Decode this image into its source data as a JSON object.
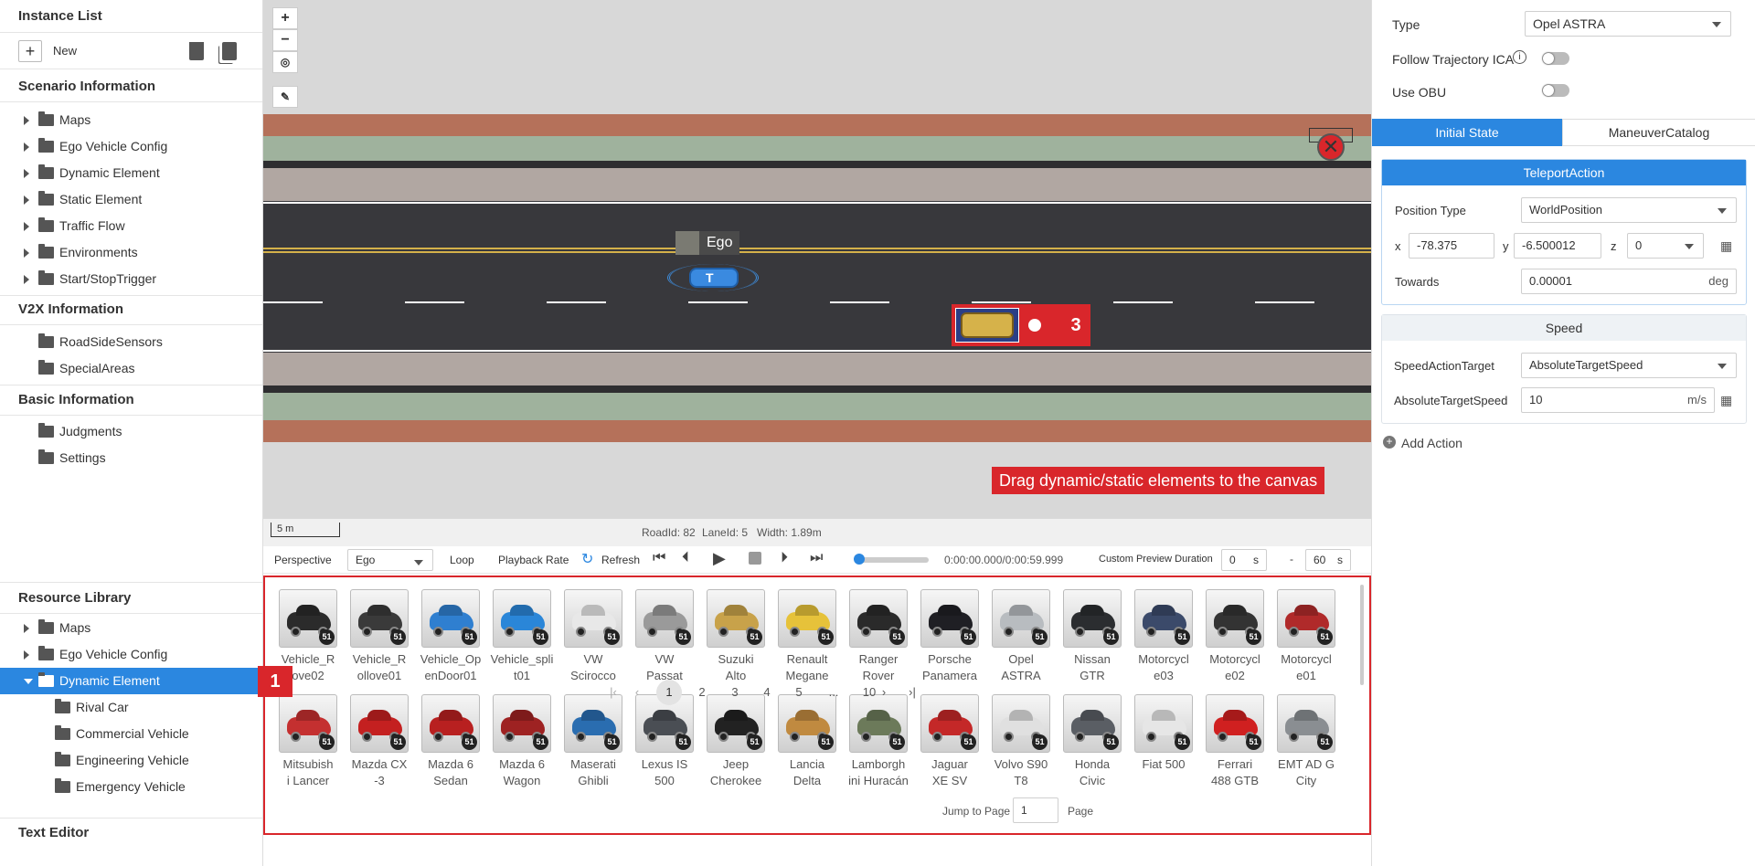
{
  "instance_list": {
    "title": "Instance List",
    "new_label": "New"
  },
  "scenario_info": {
    "title": "Scenario Information",
    "items": [
      "Maps",
      "Ego Vehicle Config",
      "Dynamic Element",
      "Static Element",
      "Traffic Flow",
      "Environments",
      "Start/StopTrigger"
    ]
  },
  "v2x_info": {
    "title": "V2X Information",
    "items": [
      "RoadSideSensors",
      "SpecialAreas"
    ]
  },
  "basic_info": {
    "title": "Basic Information",
    "items": [
      "Judgments",
      "Settings"
    ]
  },
  "resource_library": {
    "title": "Resource Library",
    "items": [
      "Maps",
      "Ego Vehicle Config",
      "Dynamic Element"
    ],
    "sub_items": [
      "Rival Car",
      "Commercial Vehicle",
      "Engineering Vehicle",
      "Emergency Vehicle"
    ]
  },
  "text_editor": {
    "title": "Text Editor"
  },
  "canvas": {
    "zoom_in": "+",
    "zoom_out": "−",
    "ego_label": "Ego",
    "rival_number": "3",
    "hint": "Drag dynamic/static elements to the canvas",
    "scale": "5 m",
    "road_id": "RoadId: 82",
    "lane_id": "LaneId: 5",
    "width": "Width: 1.89m"
  },
  "player": {
    "perspective_label": "Perspective",
    "perspective_value": "Ego",
    "loop_label": "Loop",
    "playback_rate_label": "Playback Rate",
    "refresh_label": "Refresh",
    "time": "0:00:00.000/0:00:59.999",
    "custom_preview_label": "Custom Preview Duration",
    "preview_start": "0",
    "preview_end": "60",
    "unit": "s",
    "dash": "-"
  },
  "markers": {
    "one": "1",
    "two": "2"
  },
  "vehicles_row1": [
    {
      "name1": "Vehicle_R",
      "name2": "ove02",
      "color": "#2b2b2b"
    },
    {
      "name1": "Vehicle_R",
      "name2": "ollove01",
      "color": "#3a3a3a"
    },
    {
      "name1": "Vehicle_Op",
      "name2": "enDoor01",
      "color": "#2f7fd0"
    },
    {
      "name1": "Vehicle_spli",
      "name2": "t01",
      "color": "#2a86d8"
    },
    {
      "name1": "VW",
      "name2": "Scirocco",
      "color": "#e8e8e8"
    },
    {
      "name1": "VW",
      "name2": "Passat",
      "color": "#9a9a9a"
    },
    {
      "name1": "Suzuki",
      "name2": "Alto",
      "color": "#c8a24a"
    },
    {
      "name1": "Renault",
      "name2": "Megane",
      "color": "#e6c23a"
    },
    {
      "name1": "Ranger",
      "name2": "Rover",
      "color": "#2a2a2a"
    },
    {
      "name1": "Porsche",
      "name2": "Panamera",
      "color": "#1f1f24"
    },
    {
      "name1": "Opel",
      "name2": "ASTRA",
      "color": "#b8bcc0"
    },
    {
      "name1": "Nissan",
      "name2": "GTR",
      "color": "#2b2d30"
    },
    {
      "name1": "Motorcycl",
      "name2": "e03",
      "color": "#3b4a6a"
    },
    {
      "name1": "Motorcycl",
      "name2": "e02",
      "color": "#333333"
    },
    {
      "name1": "Motorcycl",
      "name2": "e01",
      "color": "#b02a2a"
    }
  ],
  "vehicles_row2": [
    {
      "name1": "Mitsubish",
      "name2": "i Lancer",
      "color": "#c43030"
    },
    {
      "name1": "Mazda CX",
      "name2": "-3",
      "color": "#c42020"
    },
    {
      "name1": "Mazda 6",
      "name2": "Sedan",
      "color": "#b82020"
    },
    {
      "name1": "Mazda 6",
      "name2": "Wagon",
      "color": "#9e2222"
    },
    {
      "name1": "Maserati",
      "name2": "Ghibli",
      "color": "#2a6db0"
    },
    {
      "name1": "Lexus IS",
      "name2": "500",
      "color": "#4a4e54"
    },
    {
      "name1": "Jeep",
      "name2": "Cherokee",
      "color": "#222222"
    },
    {
      "name1": "Lancia",
      "name2": "Delta",
      "color": "#c08a40"
    },
    {
      "name1": "Lamborgh",
      "name2": "ini Huracán",
      "color": "#6c7a5a"
    },
    {
      "name1": "Jaguar",
      "name2": "XE SV",
      "color": "#c42828"
    },
    {
      "name1": "Volvo S90",
      "name2": "T8",
      "color": "#e0e0e0"
    },
    {
      "name1": "Honda",
      "name2": "Civic",
      "color": "#5a5e64"
    },
    {
      "name1": "Fiat 500",
      "name2": "",
      "color": "#e6e6e6"
    },
    {
      "name1": "Ferrari",
      "name2": "488 GTB",
      "color": "#d02020"
    },
    {
      "name1": "EMT AD G",
      "name2": "City",
      "color": "#8a8e92"
    }
  ],
  "badge": "51",
  "pagination": {
    "pages": [
      "1",
      "2",
      "3",
      "4",
      "5",
      "...",
      "10"
    ],
    "jump_label": "Jump to Page",
    "jump_value": "1",
    "page_label": "Page"
  },
  "properties": {
    "type_label": "Type",
    "type_value": "Opel ASTRA",
    "follow_label": "Follow Trajectory ICA",
    "obu_label": "Use OBU",
    "tab_initial": "Initial State",
    "tab_maneuver": "ManeuverCatalog",
    "teleport_title": "TeleportAction",
    "position_type_label": "Position Type",
    "position_type_value": "WorldPosition",
    "x_label": "x",
    "x_value": "-78.375",
    "y_label": "y",
    "y_value": "-6.500012",
    "z_label": "z",
    "z_value": "0",
    "towards_label": "Towards",
    "towards_value": "0.00001",
    "towards_unit": "deg",
    "speed_title": "Speed",
    "speed_target_label": "SpeedActionTarget",
    "speed_target_value": "AbsoluteTargetSpeed",
    "abs_speed_label": "AbsoluteTargetSpeed",
    "abs_speed_value": "10",
    "abs_speed_unit": "m/s",
    "add_action": "Add Action"
  },
  "colors": {
    "accent": "#2b87e0",
    "marker_red": "#d9262b",
    "road": "#38383c"
  }
}
